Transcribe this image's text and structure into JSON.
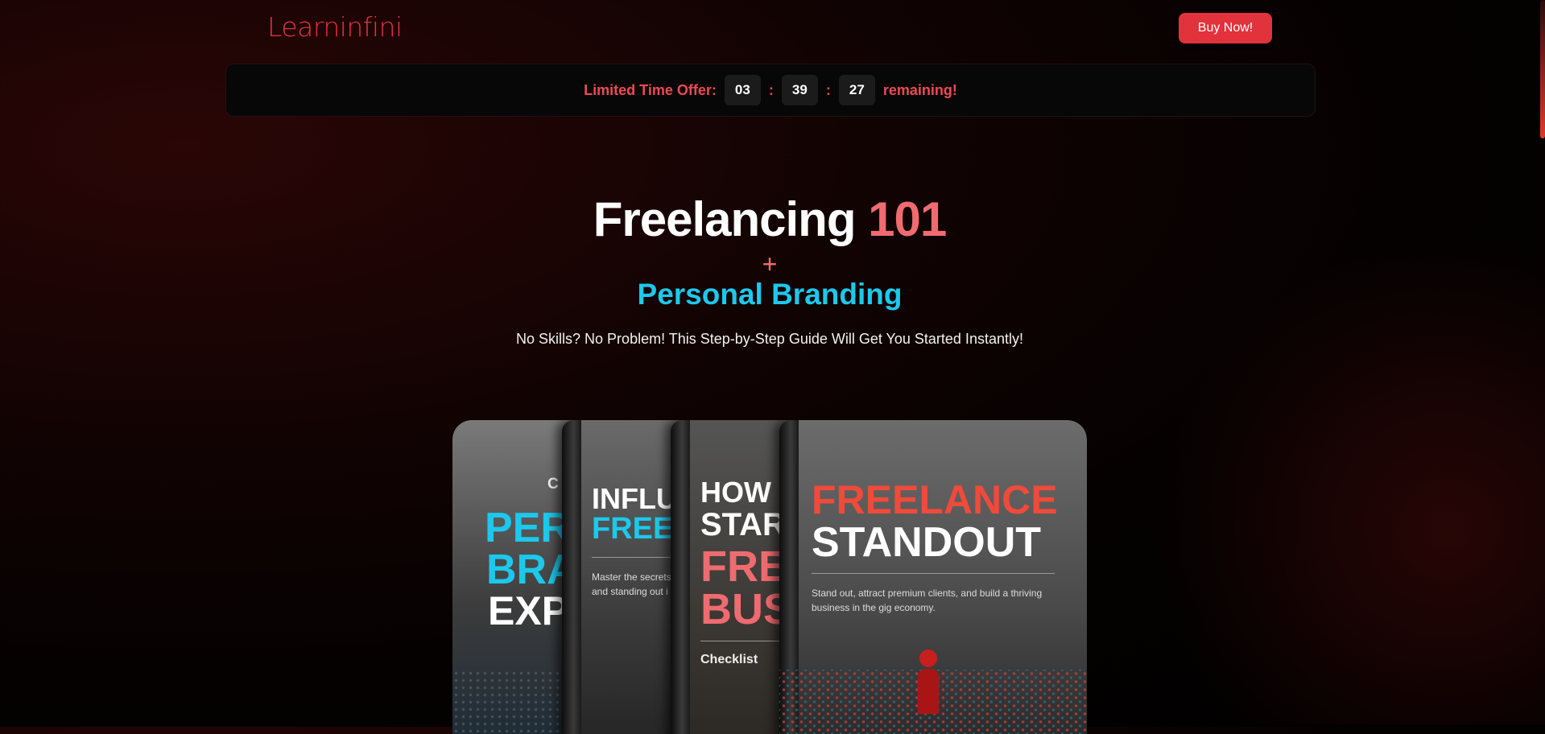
{
  "header": {
    "logo": "Learninfini",
    "buy_button": "Buy Now!"
  },
  "offer": {
    "label": "Limited Time Offer:",
    "hours": "03",
    "minutes": "39",
    "seconds": "27",
    "sep": ":",
    "suffix": "remaining!"
  },
  "hero": {
    "title_main": "Freelancing",
    "title_accent": "101",
    "plus": "+",
    "subtitle": "Personal Branding",
    "tagline": "No Skills? No Problem! This Step-by-Step Guide Will Get You Started Instantly!"
  },
  "books": [
    {
      "top": "C",
      "line1": "PER",
      "line2": "BRA",
      "line3": "EXP"
    },
    {
      "line1": "INFLU",
      "line2": "FREE",
      "desc": "Master the secrets and standing out i"
    },
    {
      "line1": "HOW",
      "line2": "STAR",
      "line3": "FREE",
      "line4": "BUS",
      "label": "Checklist"
    },
    {
      "line1": "FREELANCE",
      "line2": "STANDOUT",
      "desc": "Stand out, attract premium clients, and build a thriving business in the gig economy."
    }
  ],
  "colors": {
    "accent_red": "#e2323b",
    "accent_pink": "#f06b70",
    "accent_cyan": "#1cc9ec"
  }
}
